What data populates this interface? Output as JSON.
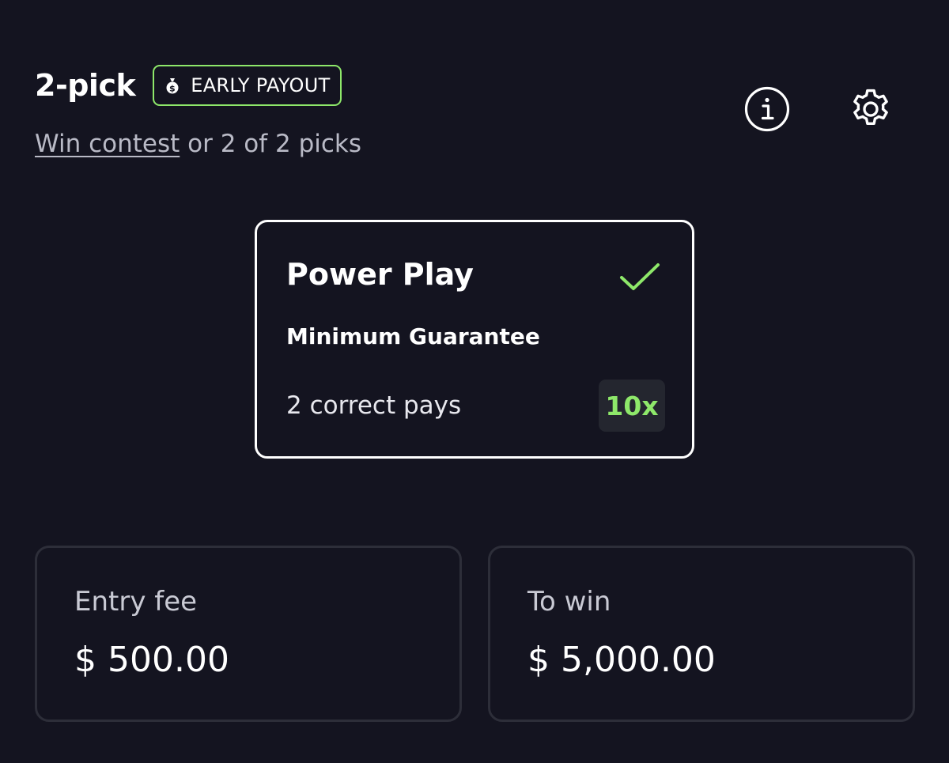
{
  "header": {
    "title": "2-pick",
    "badge_label": "EARLY PAYOUT",
    "badge_icon": "money-bag-icon",
    "accent_color": "#8ee86a"
  },
  "subtitle": {
    "link_text": "Win contest",
    "rest_text": "or 2 of 2 picks"
  },
  "toolbar": {
    "info_icon": "info-icon",
    "settings_icon": "gear-icon"
  },
  "power_play": {
    "title": "Power Play",
    "selected": true,
    "check_icon": "checkmark-icon",
    "subtitle": "Minimum Guarantee",
    "row_label": "2 correct pays",
    "multiplier": "10x"
  },
  "entry": {
    "label": "Entry fee",
    "value": "$ 500.00"
  },
  "payout": {
    "label": "To win",
    "value": "$ 5,000.00"
  },
  "colors": {
    "background": "#141420",
    "accent": "#8ee86a",
    "card_border": "#2d2e39"
  }
}
